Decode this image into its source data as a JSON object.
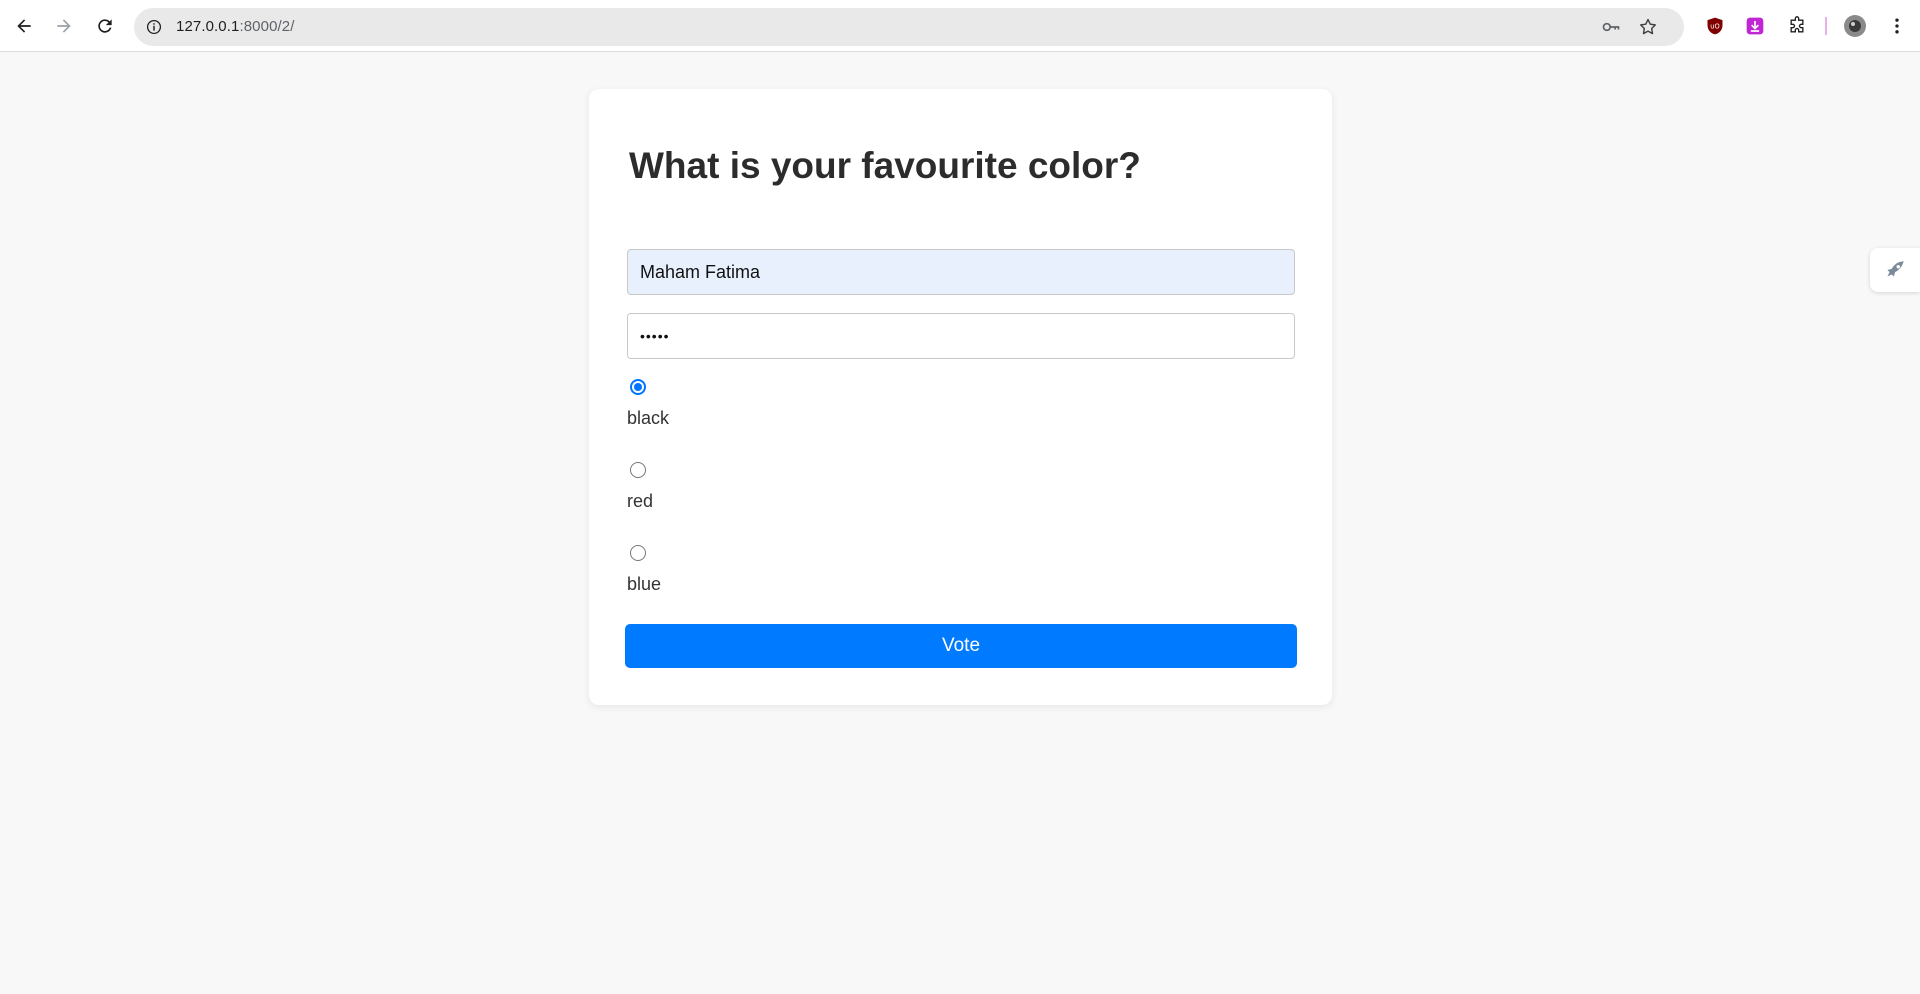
{
  "browser": {
    "url_host": "127.0.0.1",
    "url_rest": ":8000/2/"
  },
  "form": {
    "title": "What is your favourite color?",
    "name_value": "Maham Fatima",
    "password_value": "•••••",
    "options": [
      {
        "label": "black",
        "checked": true
      },
      {
        "label": "red",
        "checked": false
      },
      {
        "label": "blue",
        "checked": false
      }
    ],
    "submit_label": "Vote"
  },
  "colors": {
    "accent": "#007bff",
    "autofill": "#e8f0fe"
  }
}
